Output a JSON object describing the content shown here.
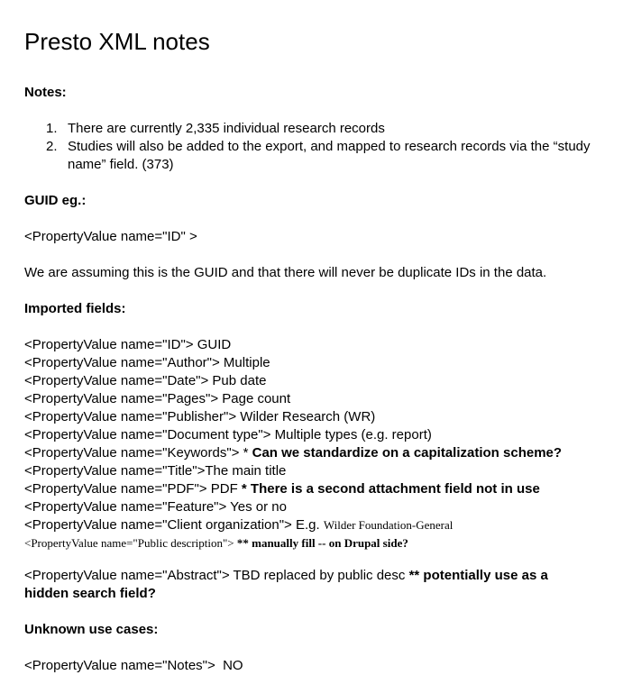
{
  "title": "Presto XML notes",
  "notes_heading": "Notes:",
  "notes_items": [
    {
      "num": "1.",
      "text": "There are currently 2,335 individual research records"
    },
    {
      "num": "2.",
      "text": "Studies will also be added to the export, and mapped to research records via the “study name” field. (373)"
    }
  ],
  "guid_heading": "GUID eg.:",
  "guid_example": "<PropertyValue name=\"ID\" >",
  "guid_assumption": "We are assuming this is the GUID and that there will never be duplicate IDs in the data.",
  "imported_heading": "Imported fields:",
  "fields": [
    {
      "tag": "<PropertyValue name=\"ID\">",
      "desc": " GUID",
      "bold": ""
    },
    {
      "tag": "<PropertyValue name=\"Author\">",
      "desc": " Multiple",
      "bold": ""
    },
    {
      "tag": "<PropertyValue name=\"Date\">",
      "desc": " Pub date",
      "bold": ""
    },
    {
      "tag": "<PropertyValue name=\"Pages\">",
      "desc": " Page count",
      "bold": ""
    },
    {
      "tag": "<PropertyValue name=\"Publisher\">",
      "desc": " Wilder Research (WR)",
      "bold": ""
    },
    {
      "tag": "<PropertyValue name=\"Document type\">",
      "desc": " Multiple types (e.g. report)",
      "bold": ""
    },
    {
      "tag": "<PropertyValue name=\"Keywords\">",
      "desc": " * ",
      "bold": "Can we standardize on a capitalization scheme?"
    },
    {
      "tag": "<PropertyValue name=\"Title\">",
      "desc": "The main title",
      "bold": ""
    },
    {
      "tag": "<PropertyValue name=\"PDF\">",
      "desc": " PDF ",
      "bold": "* There is a second attachment field not in use"
    },
    {
      "tag": "<PropertyValue name=\"Feature\">",
      "desc": " Yes or no",
      "bold": ""
    }
  ],
  "client_field": {
    "tag": "<PropertyValue name=\"Client organization\">",
    "desc": " E.g. ",
    "serif": "Wilder Foundation-General"
  },
  "public_desc_field": {
    "tag": "<PropertyValue name=\"Public description\">",
    "bold": " ** manually fill -- on Drupal side?"
  },
  "abstract_field": {
    "tag": "<PropertyValue name=\"Abstract\">",
    "desc": " TBD replaced by public desc ",
    "bold": "** potentially use as a hidden search field?"
  },
  "unknown_heading": "Unknown use cases:",
  "unknown_fields": [
    {
      "tag": "<PropertyValue name=\"Notes\">",
      "desc": "  NO"
    }
  ]
}
